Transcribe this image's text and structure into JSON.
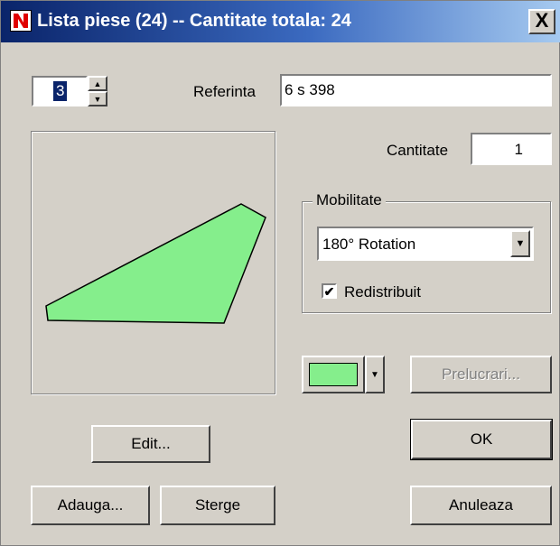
{
  "window": {
    "title": "Lista piese (24) -- Cantitate totala: 24",
    "close_label": "X"
  },
  "piece_index": {
    "value": "3"
  },
  "referinta": {
    "label": "Referinta",
    "value": "6 s 398"
  },
  "cantitate": {
    "label": "Cantitate",
    "value": "1"
  },
  "mobilitate": {
    "group_label": "Mobilitate",
    "selected": "180° Rotation",
    "redistribuit": {
      "label": "Redistribuit",
      "checked": true
    }
  },
  "color": {
    "swatch": "#85ee8c"
  },
  "buttons": {
    "prelucrari": "Prelucrari...",
    "edit": "Edit...",
    "ok": "OK",
    "adauga": "Adauga...",
    "sterge": "Sterge",
    "anuleaza": "Anuleaza"
  },
  "colors": {
    "face": "#d4d0c8",
    "title_start": "#0a246a",
    "title_end": "#a6caf0",
    "shape_fill": "#85ee8c",
    "shape_stroke": "#000000"
  }
}
